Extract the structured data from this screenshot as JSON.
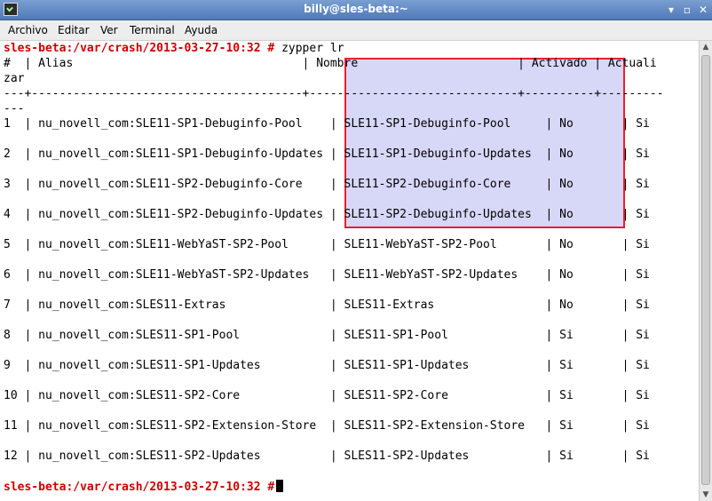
{
  "window": {
    "title": "billy@sles-beta:~",
    "minimize": "▾",
    "maximize": "▫",
    "close": "✕"
  },
  "menu": [
    "Archivo",
    "Editar",
    "Ver",
    "Terminal",
    "Ayuda"
  ],
  "terminal": {
    "prompt": "sles-beta:/var/crash/2013-03-27-10:32 #",
    "command": " zypper lr",
    "header1": "#  | Alias                                 | Nombre                       | Activado | Actuali",
    "header2": "zar",
    "sep1": "---+---------------------------------------+------------------------------+----------+---------",
    "sep2": "---",
    "rows": [
      "1  | nu_novell_com:SLE11-SP1-Debuginfo-Pool    | SLE11-SP1-Debuginfo-Pool     | No       | Si",
      "2  | nu_novell_com:SLE11-SP1-Debuginfo-Updates | SLE11-SP1-Debuginfo-Updates  | No       | Si",
      "3  | nu_novell_com:SLE11-SP2-Debuginfo-Core    | SLE11-SP2-Debuginfo-Core     | No       | Si",
      "4  | nu_novell_com:SLE11-SP2-Debuginfo-Updates | SLE11-SP2-Debuginfo-Updates  | No       | Si",
      "5  | nu_novell_com:SLE11-WebYaST-SP2-Pool      | SLE11-WebYaST-SP2-Pool       | No       | Si",
      "6  | nu_novell_com:SLE11-WebYaST-SP2-Updates   | SLE11-WebYaST-SP2-Updates    | No       | Si",
      "7  | nu_novell_com:SLES11-Extras               | SLES11-Extras                | No       | Si",
      "8  | nu_novell_com:SLES11-SP1-Pool             | SLES11-SP1-Pool              | Si       | Si",
      "9  | nu_novell_com:SLES11-SP1-Updates          | SLES11-SP1-Updates           | Si       | Si",
      "10 | nu_novell_com:SLES11-SP2-Core             | SLES11-SP2-Core              | Si       | Si",
      "11 | nu_novell_com:SLES11-SP2-Extension-Store  | SLES11-SP2-Extension-Store   | Si       | Si",
      "12 | nu_novell_com:SLES11-SP2-Updates          | SLES11-SP2-Updates           | Si       | Si"
    ]
  }
}
